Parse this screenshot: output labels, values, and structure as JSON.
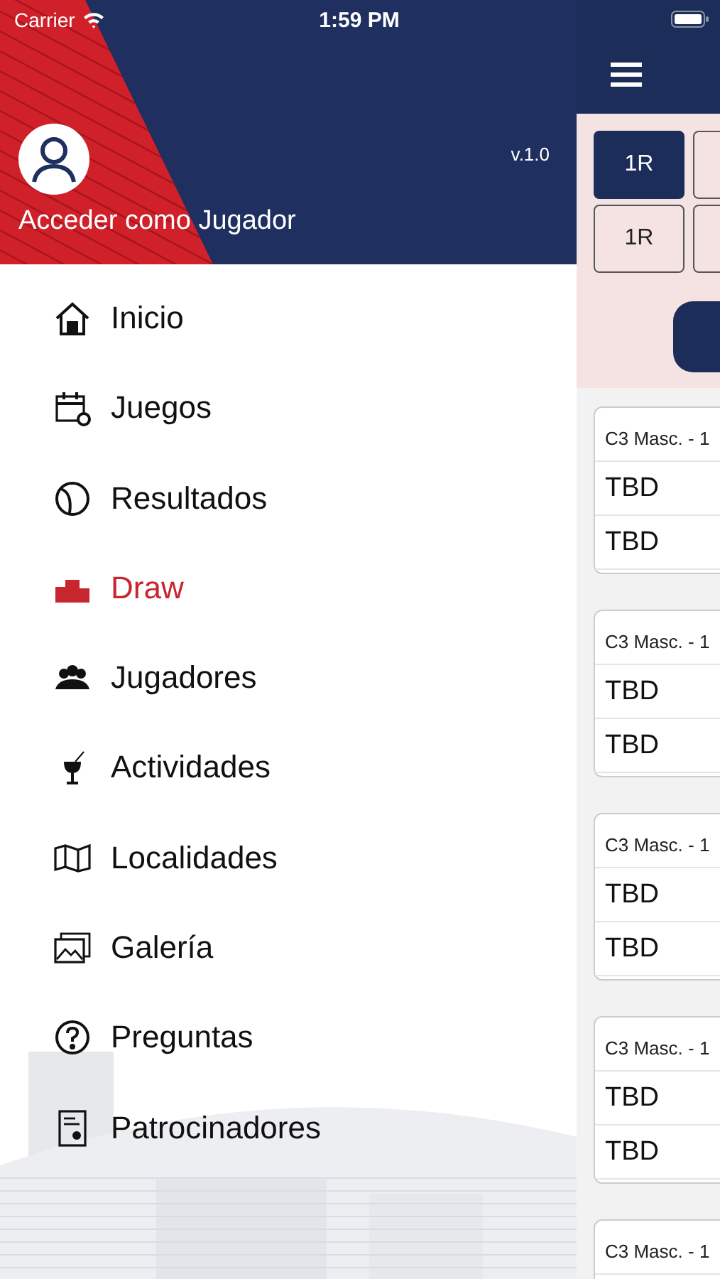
{
  "status_bar": {
    "carrier": "Carrier",
    "time": "1:59 PM"
  },
  "drawer": {
    "account_label": "Acceder como Jugador",
    "version": "v.1.0",
    "menu": [
      {
        "label": "Inicio",
        "selected": false
      },
      {
        "label": "Juegos",
        "selected": false
      },
      {
        "label": "Resultados",
        "selected": false
      },
      {
        "label": "Draw",
        "selected": true
      },
      {
        "label": "Jugadores",
        "selected": false
      },
      {
        "label": "Actividades",
        "selected": false
      },
      {
        "label": "Localidades",
        "selected": false
      },
      {
        "label": "Galería",
        "selected": false
      },
      {
        "label": "Preguntas",
        "selected": false
      },
      {
        "label": "Patrocinadores",
        "selected": false
      }
    ]
  },
  "main": {
    "round_buttons": [
      {
        "label": "1R",
        "selected": true
      },
      {
        "label": "1R",
        "selected": false
      }
    ],
    "match_cards": [
      {
        "title": "C3 Masc. - 1",
        "players": [
          "TBD",
          "TBD"
        ]
      },
      {
        "title": "C3 Masc. - 1",
        "players": [
          "TBD",
          "TBD"
        ]
      },
      {
        "title": "C3 Masc. - 1",
        "players": [
          "TBD",
          "TBD"
        ]
      },
      {
        "title": "C3 Masc. - 1",
        "players": [
          "TBD",
          "TBD"
        ]
      },
      {
        "title": "C3 Masc. - 1"
      }
    ]
  }
}
